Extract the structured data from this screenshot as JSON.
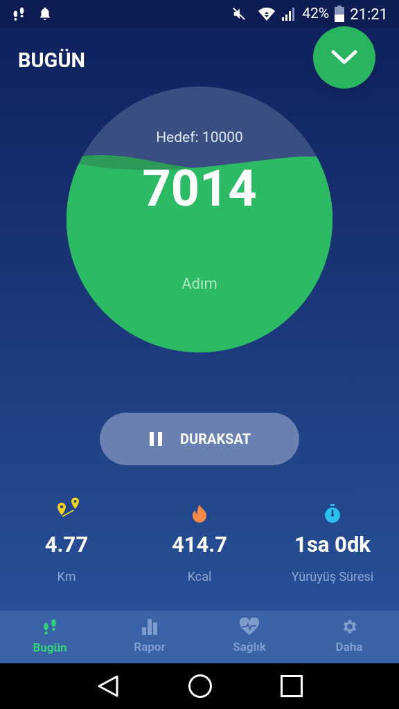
{
  "status_bar": {
    "battery": "42%",
    "time": "21:21"
  },
  "title": "BUGÜN",
  "goal": {
    "label": "Hedef: 10000",
    "steps": "7014",
    "unit": "Adım"
  },
  "pause_button": {
    "label": "DURAKSAT"
  },
  "stats": [
    {
      "kind": "distance",
      "value": "4.77",
      "label": "Km"
    },
    {
      "kind": "calories",
      "value": "414.7",
      "label": "Kcal"
    },
    {
      "kind": "time",
      "value": "1sa 0dk",
      "label": "Yürüyüş Süresi"
    }
  ],
  "tabs": [
    {
      "kind": "today",
      "label": "Bugün",
      "selected": true
    },
    {
      "kind": "report",
      "label": "Rapor",
      "selected": false
    },
    {
      "kind": "health",
      "label": "Sağlık",
      "selected": false
    },
    {
      "kind": "more",
      "label": "Daha",
      "selected": false
    }
  ]
}
